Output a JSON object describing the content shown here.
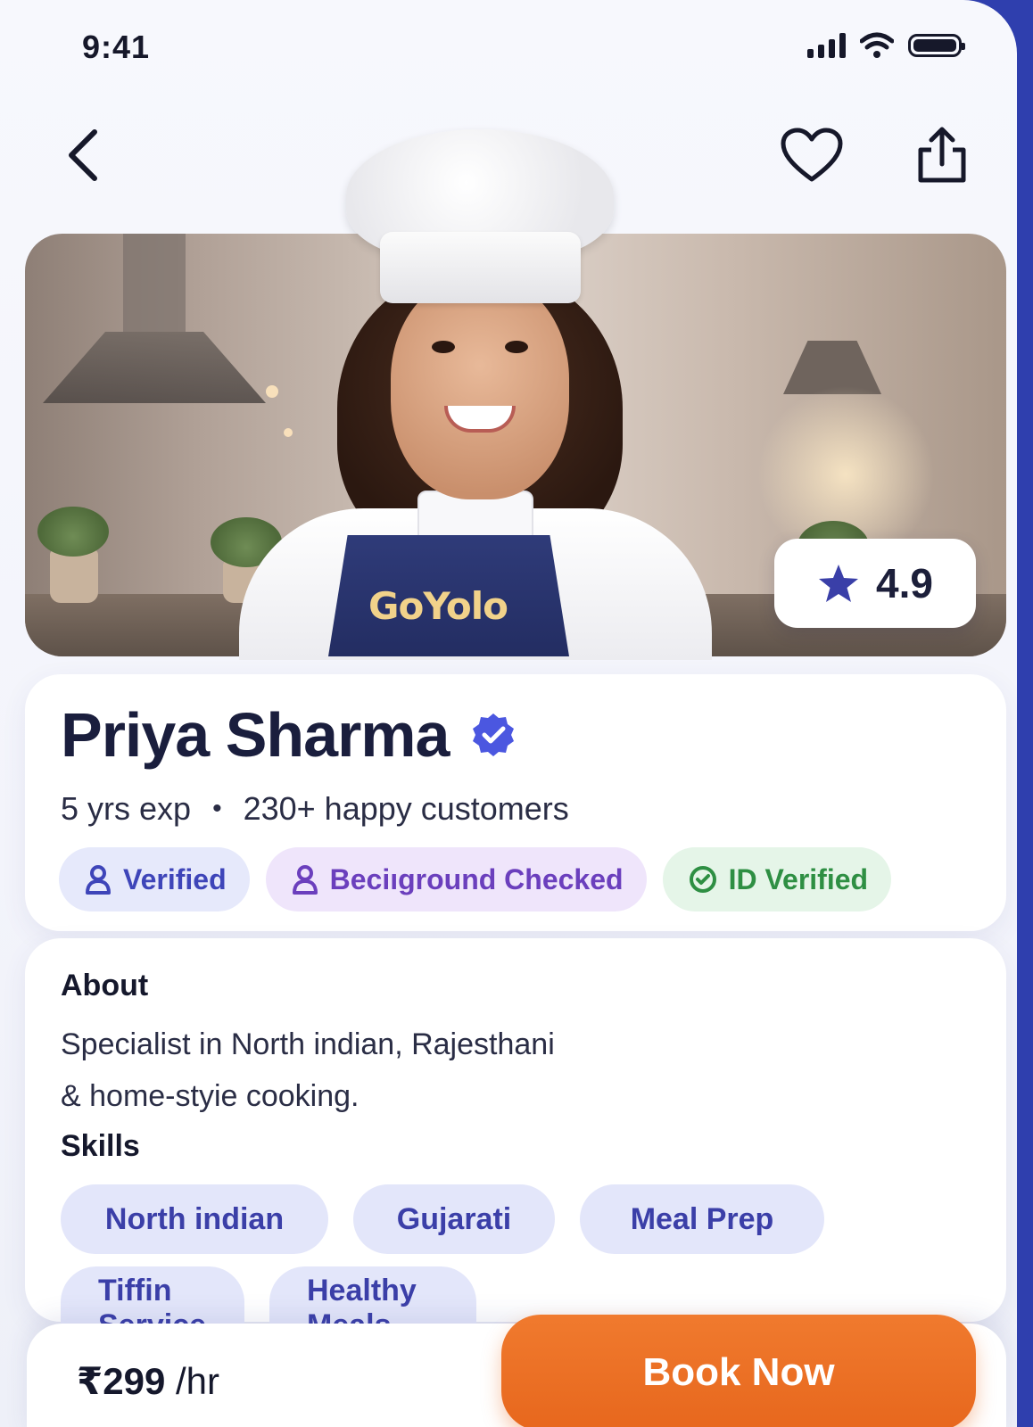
{
  "status_bar": {
    "time": "9:41",
    "icons": [
      "signal-icon",
      "wifi-icon",
      "battery-icon"
    ]
  },
  "nav": {
    "back_icon": "chevron-left-icon",
    "favorite_icon": "heart-icon",
    "share_icon": "share-icon"
  },
  "hero": {
    "apron_logo": "GoYolo",
    "rating_value": "4.9",
    "rating_icon": "star-icon"
  },
  "profile": {
    "name": "Priya Sharma",
    "verified_icon": "verified-check-icon",
    "experience": "5 yrs exp",
    "separator": "•",
    "customers": "230+ happy customers",
    "badges": [
      {
        "label": "Verified",
        "icon": "user-shield-icon",
        "color": "#3e45b9"
      },
      {
        "label": "Beciıground Checked",
        "icon": "user-icon",
        "color": "#6b3fbd"
      },
      {
        "label": "ID Verified",
        "icon": "check-circle-icon",
        "color": "#2e8f43"
      }
    ]
  },
  "about": {
    "title": "About",
    "text_line1": "Specialist in North indian, Rajesthani",
    "text_line2": "& home-styie cooking.",
    "skills_title": "Skills",
    "skills": [
      "North indian",
      "Gujarati",
      "Meal Prep",
      "Tiffin Service",
      "Healthy Meals"
    ]
  },
  "footer": {
    "price": "₹299",
    "unit": "/hr",
    "book_label": "Book Now"
  },
  "colors": {
    "accent": "#3e45b9",
    "cta": "#e7671d",
    "frame": "#2f3fae"
  }
}
